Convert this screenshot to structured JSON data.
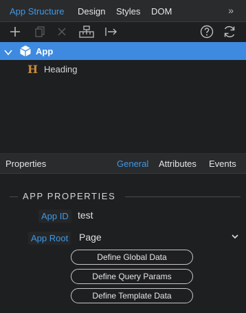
{
  "tabs": {
    "items": [
      "App Structure",
      "Design",
      "Styles",
      "DOM"
    ],
    "more": "»"
  },
  "toolbar": {
    "icons": [
      "add-icon",
      "duplicate-icon",
      "delete-icon",
      "component-icon",
      "move-to-icon",
      "help-icon",
      "refresh-icon"
    ]
  },
  "tree": {
    "app_label": "App",
    "heading_label": "Heading",
    "heading_glyph": "H"
  },
  "properties": {
    "title": "Properties",
    "tabs": [
      "General",
      "Attributes",
      "Events"
    ],
    "section_title": "APP PROPERTIES",
    "app_id_label": "App ID",
    "app_id_value": "test",
    "app_root_label": "App Root",
    "app_root_value": "Page",
    "buttons": [
      "Define Global Data",
      "Define Query Params",
      "Define Template Data"
    ]
  },
  "colors": {
    "accent": "#3d9ae8",
    "selected_row": "#3d8ae0",
    "background": "#1e1f21",
    "heading_icon": "#c98a3c"
  }
}
